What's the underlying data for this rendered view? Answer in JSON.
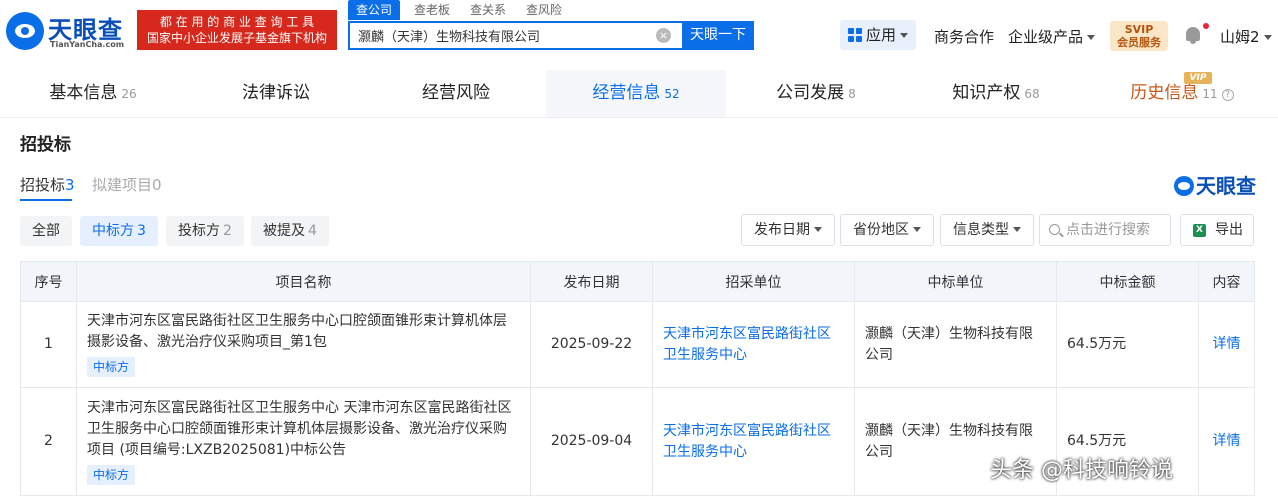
{
  "header": {
    "logo_name": "天眼查",
    "logo_domain": "TianYanCha.com",
    "slogan_line1": "都 在 用 的 商 业 查 询 工 具",
    "slogan_line2": "国家中小企业发展子基金旗下机构",
    "search_tabs": [
      "查公司",
      "查老板",
      "查关系",
      "查风险"
    ],
    "search_value": "灏麟（天津）生物科技有限公司",
    "search_button": "天眼一下",
    "apps_label": "应用",
    "nav_links": [
      "商务合作",
      "企业级产品"
    ],
    "svip_line1": "SVIP",
    "svip_line2": "会员服务",
    "user_name": "山姆2"
  },
  "main_tabs": [
    {
      "label": "基本信息",
      "count": "26"
    },
    {
      "label": "法律诉讼",
      "count": ""
    },
    {
      "label": "经营风险",
      "count": ""
    },
    {
      "label": "经营信息",
      "count": "52"
    },
    {
      "label": "公司发展",
      "count": "8"
    },
    {
      "label": "知识产权",
      "count": "68"
    },
    {
      "label": "历史信息",
      "count": "11"
    }
  ],
  "vip_badge": "VIP",
  "section": {
    "title": "招投标",
    "sub_tabs": [
      {
        "label": "招投标",
        "count": "3"
      },
      {
        "label": "拟建项目",
        "count": "0"
      }
    ],
    "watermark_logo": "天眼查",
    "chips": [
      {
        "label": "全部",
        "count": ""
      },
      {
        "label": "中标方",
        "count": "3"
      },
      {
        "label": "投标方",
        "count": "2"
      },
      {
        "label": "被提及",
        "count": "4"
      }
    ],
    "dropdowns": [
      "发布日期",
      "省份地区",
      "信息类型"
    ],
    "search_placeholder": "点击进行搜索",
    "export_label": "导出"
  },
  "table": {
    "headers": [
      "序号",
      "项目名称",
      "发布日期",
      "招采单位",
      "中标单位",
      "中标金额",
      "内容"
    ],
    "rows": [
      {
        "no": "1",
        "name": "天津市河东区富民路街社区卫生服务中心口腔颌面锥形束计算机体层摄影设备、激光治疗仪采购项目_第1包",
        "tag": "中标方",
        "date": "2025-09-22",
        "buyer": "天津市河东区富民路街社区卫生服务中心",
        "winner": "灏麟（天津）生物科技有限公司",
        "amount": "64.5万元",
        "action": "详情"
      },
      {
        "no": "2",
        "name": "天津市河东区富民路街社区卫生服务中心 天津市河东区富民路街社区卫生服务中心口腔颌面锥形束计算机体层摄影设备、激光治疗仪采购项目 (项目编号:LXZB2025081)中标公告",
        "tag": "中标方",
        "date": "2025-09-04",
        "buyer": "天津市河东区富民路街社区卫生服务中心",
        "winner": "灏麟（天津）生物科技有限公司",
        "amount": "64.5万元",
        "action": "详情"
      }
    ]
  },
  "overlay_watermark": "头条 @科技响铃说",
  "colors": {
    "brand": "#0a6ee8",
    "slogan_bg": "#d6281c",
    "history": "#c8581a"
  }
}
